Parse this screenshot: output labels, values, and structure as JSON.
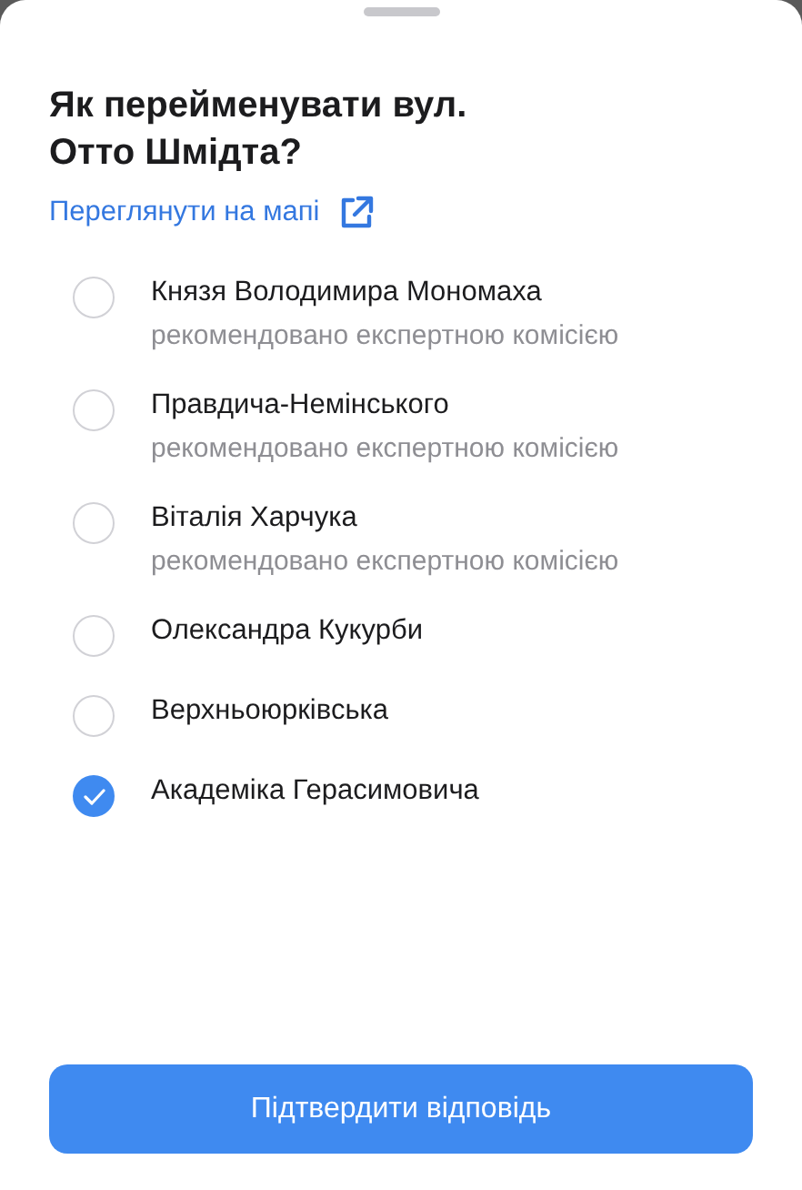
{
  "title": "Як перейменувати вул. Отто Шмідта?",
  "map_link": {
    "label": "Переглянути на мапі"
  },
  "options": [
    {
      "name": "Князя Володимира Мономаха",
      "note": "рекомендовано експертною комісією",
      "selected": false
    },
    {
      "name": "Правдича-Немінського",
      "note": "рекомендовано експертною комісією",
      "selected": false
    },
    {
      "name": "Віталія Харчука",
      "note": "рекомендовано експертною комісією",
      "selected": false
    },
    {
      "name": "Олександра Кукурби",
      "selected": false
    },
    {
      "name": "Верхньоюрківська",
      "selected": false
    },
    {
      "name": "Академіка Герасимовича",
      "selected": true
    }
  ],
  "submit_button": {
    "label": "Підтвердити відповідь"
  }
}
